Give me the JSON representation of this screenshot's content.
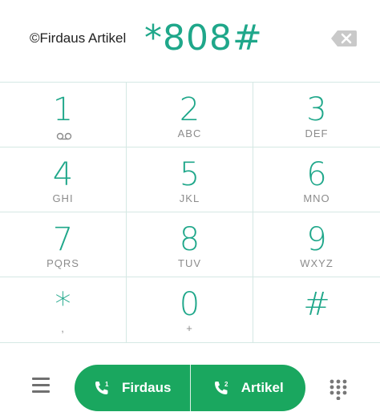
{
  "header": {
    "watermark": "©Firdaus Artikel",
    "dialed_number": "*808#"
  },
  "keypad": [
    {
      "digit": "1",
      "letters": ""
    },
    {
      "digit": "2",
      "letters": "ABC"
    },
    {
      "digit": "3",
      "letters": "DEF"
    },
    {
      "digit": "4",
      "letters": "GHI"
    },
    {
      "digit": "5",
      "letters": "JKL"
    },
    {
      "digit": "6",
      "letters": "MNO"
    },
    {
      "digit": "7",
      "letters": "PQRS"
    },
    {
      "digit": "8",
      "letters": "TUV"
    },
    {
      "digit": "9",
      "letters": "WXYZ"
    },
    {
      "digit": "*",
      "letters": ","
    },
    {
      "digit": "0",
      "letters": "+"
    },
    {
      "digit": "#",
      "letters": ""
    }
  ],
  "bottom": {
    "sim1_label": "Firdaus",
    "sim1_badge": "1",
    "sim2_label": "Artikel",
    "sim2_badge": "2"
  },
  "icons": {
    "backspace": "backspace-icon",
    "voicemail": "voicemail-icon",
    "menu": "menu-icon",
    "call_sim1": "phone-sim1-icon",
    "call_sim2": "phone-sim2-icon",
    "dialpad": "dialpad-icon"
  },
  "colors": {
    "accent": "#1fa78a",
    "call_button": "#1aa75f",
    "letters": "#8c8c8c",
    "divider": "#d5e8e4"
  }
}
